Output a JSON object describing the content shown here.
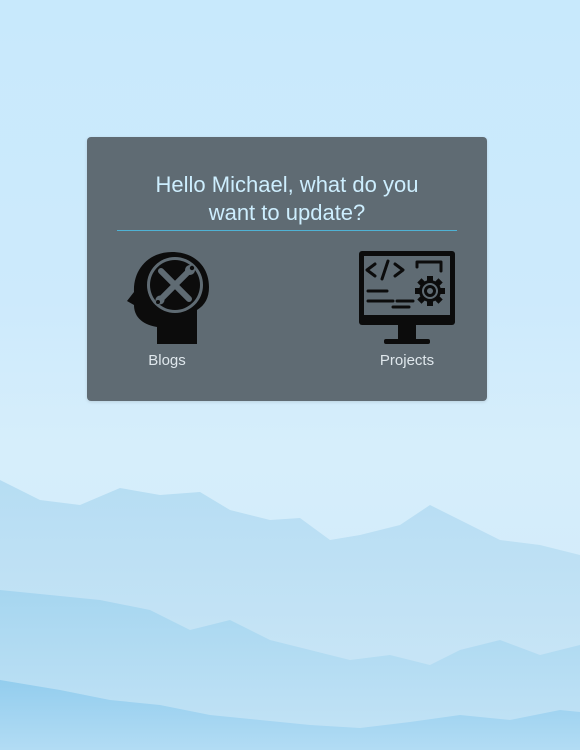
{
  "greeting": {
    "line1": "Hello Michael, what do you",
    "line2": "want to update?"
  },
  "options": [
    {
      "label": "Blogs",
      "icon": "head-tools-icon"
    },
    {
      "label": "Projects",
      "icon": "computer-code-gear-icon"
    }
  ],
  "colors": {
    "card": "#5f6b73",
    "title": "#cdeefe",
    "divider": "#4fb2d4",
    "label": "#dfe7ec"
  }
}
